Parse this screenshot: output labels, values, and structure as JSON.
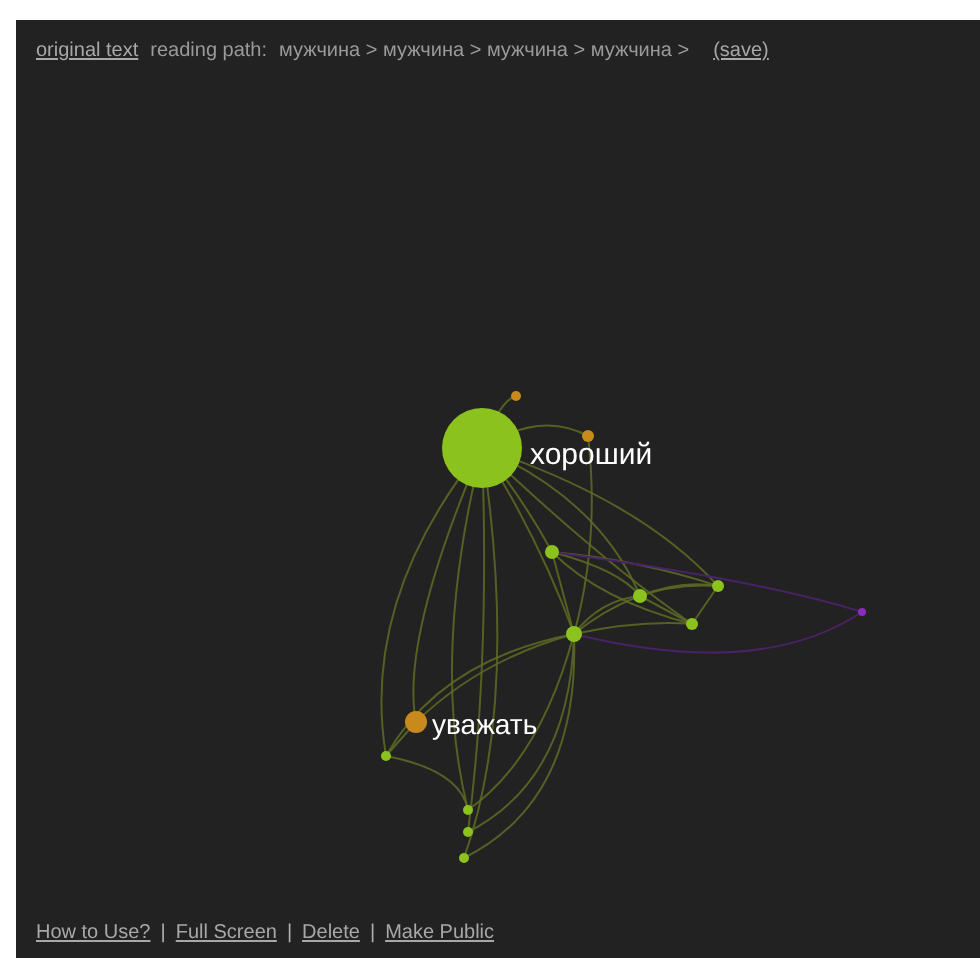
{
  "top_bar": {
    "original_text_link": "original text",
    "reading_path_label": "reading path:",
    "reading_path": "мужчина > мужчина > мужчина > мужчина >",
    "save_link": "(save)"
  },
  "graph": {
    "nodes": [
      {
        "label": "хороший",
        "color": "#8cc21e"
      },
      {
        "label": "уважать",
        "color": "#c98a1c"
      }
    ]
  },
  "footer": [
    {
      "kind": "link",
      "text": "How to Use?"
    },
    {
      "kind": "separator",
      "text": "|"
    },
    {
      "kind": "link",
      "text": "Full Screen"
    },
    {
      "kind": "separator",
      "text": "|"
    },
    {
      "kind": "link",
      "text": "Delete"
    },
    {
      "kind": "separator",
      "text": "|"
    },
    {
      "kind": "link",
      "text": "Make Public"
    }
  ]
}
